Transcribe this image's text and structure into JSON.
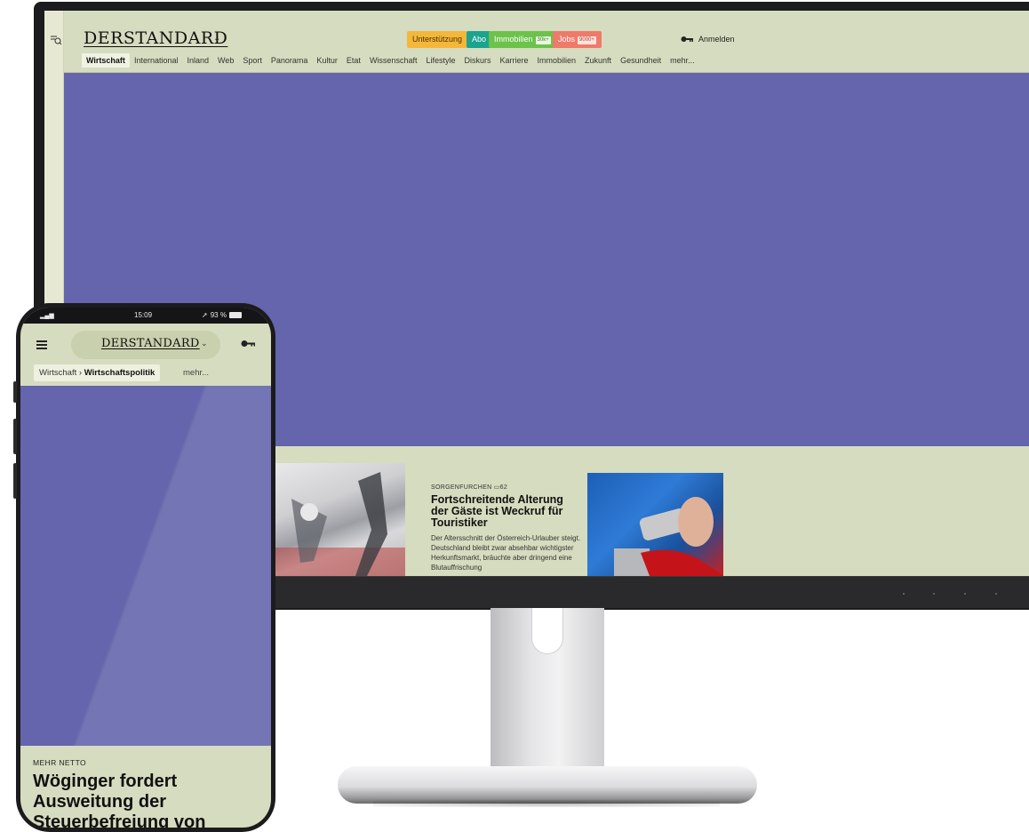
{
  "desktop": {
    "logo": "DERSTANDARD",
    "pills": [
      {
        "label": "Unterstützung",
        "bg": "#f4b73a",
        "color": "#4a3300"
      },
      {
        "label": "Abo",
        "bg": "#1aa38f",
        "color": "#ffffff"
      },
      {
        "label": "Immobilien",
        "badge": "30k+",
        "bg": "#6cc24a",
        "color": "#ffffff"
      },
      {
        "label": "Jobs",
        "badge": "9000+",
        "bg": "#ee7a6a",
        "color": "#ffffff"
      }
    ],
    "login_label": "Anmelden",
    "nav": [
      "Wirtschaft",
      "International",
      "Inland",
      "Web",
      "Sport",
      "Panorama",
      "Kultur",
      "Etat",
      "Wissenschaft",
      "Lifestyle",
      "Diskurs",
      "Karriere",
      "Immobilien",
      "Zukunft",
      "Gesundheit",
      "mehr..."
    ],
    "nav_active": "Wirtschaft",
    "article": {
      "kicker": "SORGENFURCHEN",
      "comments": "62",
      "title": "Fortschreitende Alterung der Gäste ist Weckruf für Touristiker",
      "teaser": "Der Altersschnitt der Österreich-Urlauber steigt. Deutschland bleibt zwar absehbar wichtigster Herkunftsmarkt, bräuchte aber dringend eine Blutauffrischung"
    }
  },
  "phone": {
    "time": "15:09",
    "battery": "93 %",
    "logo": "DERSTANDARD",
    "breadcrumb_parent": "Wirtschaft",
    "breadcrumb_sep": "›",
    "breadcrumb_current": "Wirtschaftspolitik",
    "more": "mehr...",
    "kicker": "MEHR NETTO",
    "title": "Wöginger fordert Ausweitung der Steuerbefreiung von"
  },
  "colors": {
    "page_bg": "#d6dcbf",
    "ad_bg": "#6465ac",
    "bezel": "#1c1c1e"
  }
}
